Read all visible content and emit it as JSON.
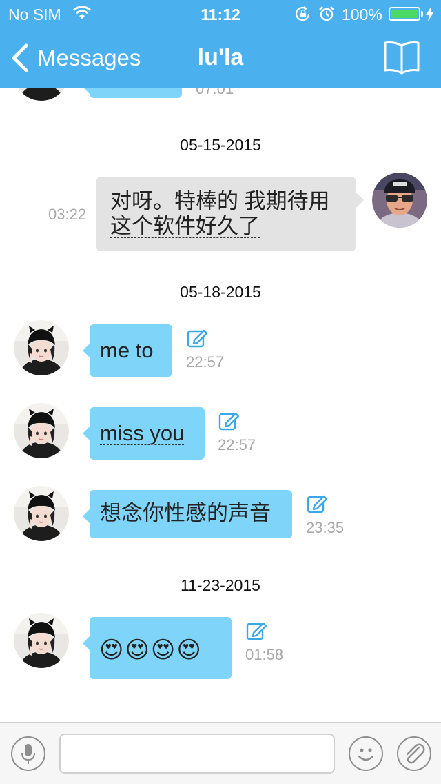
{
  "status_bar": {
    "carrier": "No SIM",
    "time": "11:12",
    "battery": "100%",
    "battery_level": 1.0
  },
  "nav": {
    "back_label": "Messages",
    "title": "lu'la"
  },
  "top_partial": {
    "time": "07:01"
  },
  "groups": [
    {
      "date": "05-15-2015"
    },
    {
      "date": "05-18-2015"
    },
    {
      "date": "11-23-2015"
    }
  ],
  "messages": [
    {
      "text": "对呀。特棒的 我期待用这个软件好久了",
      "time": "03:22"
    },
    {
      "text": "me to",
      "time": "22:57"
    },
    {
      "text": "miss you",
      "time": "22:57"
    },
    {
      "text": "想念你性感的声音",
      "time": "23:35"
    },
    {
      "text": "😍😍😍😍",
      "time": "01:58"
    }
  ],
  "input": {
    "placeholder": ""
  },
  "colors": {
    "header": "#4ab1ee",
    "incoming_bubble": "#7fd4f9",
    "outgoing_bubble": "#e3e3e3",
    "battery": "#4cd964"
  },
  "icons": [
    "back-chevron-icon",
    "book-icon",
    "edit-icon",
    "microphone-icon",
    "smiley-icon",
    "paperclip-icon",
    "wifi-icon",
    "lock-rotation-icon",
    "alarm-icon",
    "charging-bolt-icon"
  ]
}
